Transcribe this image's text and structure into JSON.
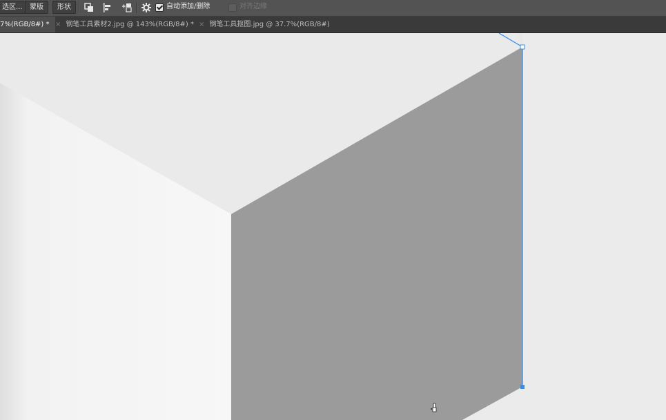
{
  "options_bar": {
    "selection_button": "选区...",
    "mask_button": "蒙版",
    "shape_button": "形状",
    "auto_add_delete": {
      "label": "自动添加/删除",
      "checked": true
    },
    "align_edges": {
      "label": "对齐边缘",
      "checked": false
    }
  },
  "tabs": [
    {
      "label": "7%(RGB/8#) *",
      "active": true
    },
    {
      "label": "钢笔工具素材2.jpg @ 143%(RGB/8#) *",
      "active": false
    },
    {
      "label": "钢笔工具抠图.jpg @ 37.7%(RGB/8#)",
      "active": false
    }
  ],
  "tab_close_glyph": "×",
  "colors": {
    "path_stroke": "#3a8ee6",
    "cube_side_face": "#9b9b9b",
    "cube_top_face": "#eaeaea",
    "cube_left_face": "#f6f6f6",
    "background": "#e9e9e9"
  },
  "cursor_icon": "pen-cursor-icon"
}
